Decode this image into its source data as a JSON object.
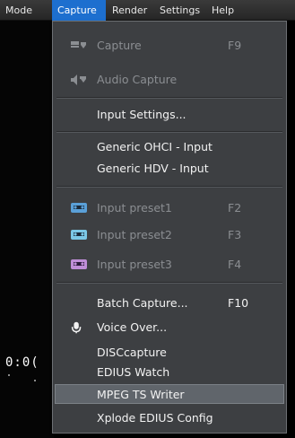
{
  "menubar": {
    "items": [
      "Mode",
      "Capture",
      "Render",
      "Settings",
      "Help"
    ]
  },
  "background": {
    "timecode": "0:0("
  },
  "dropdown": {
    "items": [
      {
        "label": "Capture",
        "shortcut": "F9",
        "enabled": false,
        "icon": "capture-icon"
      },
      {
        "label": "Audio Capture",
        "shortcut": "",
        "enabled": false,
        "icon": "audio-capture-icon"
      },
      {
        "label": "Input Settings...",
        "shortcut": "",
        "enabled": true
      },
      {
        "label": "Generic OHCI - Input",
        "shortcut": "",
        "enabled": true
      },
      {
        "label": "Generic HDV - Input",
        "shortcut": "",
        "enabled": true
      },
      {
        "label": "Input preset1",
        "shortcut": "F2",
        "enabled": false,
        "icon": "tape-icon"
      },
      {
        "label": "Input preset2",
        "shortcut": "F3",
        "enabled": false,
        "icon": "tape-icon"
      },
      {
        "label": "Input preset3",
        "shortcut": "F4",
        "enabled": false,
        "icon": "tape-icon"
      },
      {
        "label": "Batch Capture...",
        "shortcut": "F10",
        "enabled": true
      },
      {
        "label": "Voice Over...",
        "shortcut": "",
        "enabled": true,
        "icon": "microphone-icon"
      },
      {
        "label": "DISCcapture",
        "shortcut": "",
        "enabled": true
      },
      {
        "label": "EDIUS Watch",
        "shortcut": "",
        "enabled": true
      },
      {
        "label": "MPEG TS Writer",
        "shortcut": "",
        "enabled": true,
        "highlighted": true
      },
      {
        "label": "Xplode EDIUS Config",
        "shortcut": "",
        "enabled": true
      }
    ]
  },
  "colors": {
    "menubar_active": "#1d6fcf",
    "menu_bg": "#3d3f42",
    "highlight": "#60656b",
    "disabled_text": "#8b8e92",
    "preset1_icon": "#5aa0d8",
    "preset2_icon": "#7cc8e6",
    "preset3_icon": "#c08ed8"
  }
}
